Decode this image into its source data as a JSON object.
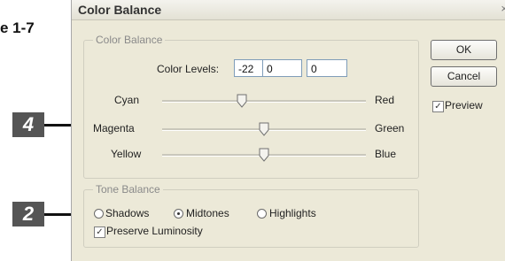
{
  "annotation": {
    "figure_label": "e 1-7",
    "callout_a": "4",
    "callout_b": "2"
  },
  "dialog": {
    "title": "Color Balance",
    "close_glyph": "×",
    "color_balance_group": {
      "legend": "Color Balance",
      "levels_label": "Color Levels:",
      "levels": [
        "-22",
        "0",
        "0"
      ],
      "sliders": [
        {
          "left": "Cyan",
          "right": "Red",
          "value": -22
        },
        {
          "left": "Magenta",
          "right": "Green",
          "value": 0
        },
        {
          "left": "Yellow",
          "right": "Blue",
          "value": 0
        }
      ]
    },
    "tone_balance_group": {
      "legend": "Tone Balance",
      "options": [
        "Shadows",
        "Midtones",
        "Highlights"
      ],
      "selected": "Midtones",
      "preserve_luminosity_label": "Preserve Luminosity",
      "preserve_luminosity_checked": true
    },
    "buttons": {
      "ok": "OK",
      "cancel": "Cancel"
    },
    "preview_label": "Preview",
    "preview_checked": true,
    "check_glyph": "✓"
  }
}
